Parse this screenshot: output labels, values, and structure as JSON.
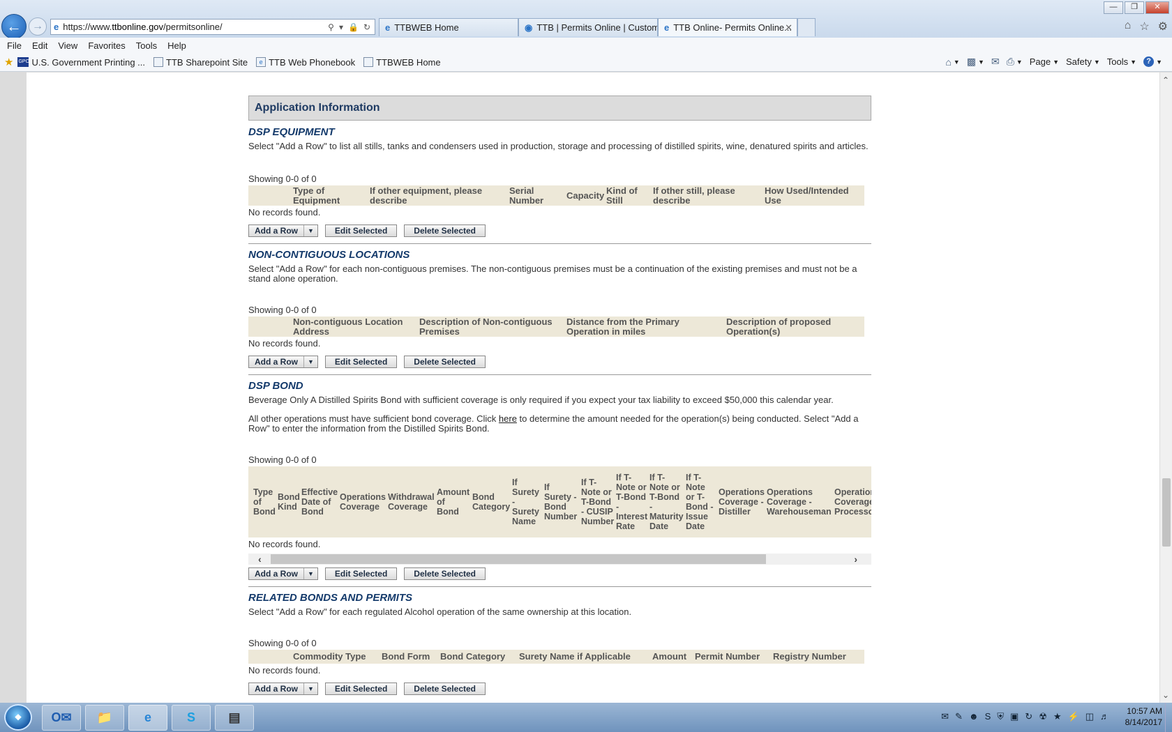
{
  "browser": {
    "url_prefix": "https://www.",
    "url_domain": "ttbonline.gov",
    "url_path": "/permitsonline/",
    "tabs": [
      {
        "label": "TTBWEB Home"
      },
      {
        "label": "TTB | Permits Online | Custom..."
      },
      {
        "label": "TTB Online- Permits Online..."
      }
    ],
    "menu": [
      "File",
      "Edit",
      "View",
      "Favorites",
      "Tools",
      "Help"
    ],
    "favorites": [
      "U.S. Government Printing ...",
      "TTB Sharepoint Site",
      "TTB Web Phonebook",
      "TTBWEB Home"
    ],
    "gpo_badge": "GPO",
    "commands": {
      "page": "Page",
      "safety": "Safety",
      "tools": "Tools"
    }
  },
  "page": {
    "app_info_title": "Application Information",
    "showing": "Showing 0-0 of 0",
    "no_records": "No records found.",
    "buttons": {
      "add_row": "Add a Row",
      "edit_selected": "Edit Selected",
      "delete_selected": "Delete Selected"
    },
    "dsp_equipment": {
      "title": "DSP EQUIPMENT",
      "description": "Select \"Add a Row\" to list all stills, tanks and condensers used in production, storage and processing of distilled spirits, wine, denatured spirits and articles.",
      "columns": [
        "Type of Equipment",
        "If other equipment, please describe",
        "Serial Number",
        "Capacity",
        "Kind of Still",
        "If other still, please describe",
        "How Used/Intended Use"
      ]
    },
    "noncontiguous": {
      "title": "NON-CONTIGUOUS LOCATIONS",
      "description": "Select \"Add a Row\" for each non-contiguous premises. The non-contiguous premises must be a continuation of the existing premises and must not be a stand alone operation.",
      "columns": [
        "Non-contiguous Location Address",
        "Description of Non-contiguous Premises",
        "Distance from the Primary Operation in miles",
        "Description of proposed Operation(s)"
      ]
    },
    "dsp_bond": {
      "title": "DSP BOND",
      "beverage_note": "Beverage Only  A Distilled Spirits Bond with sufficient coverage is only required if you expect your tax liability to exceed $50,000 this calendar year.",
      "other_ops_before": "All other operations must have sufficient bond coverage. Click ",
      "here_link": "here",
      "other_ops_after": " to determine the amount needed for the operation(s) being conducted. Select \"Add a Row\" to enter the information from the Distilled Spirits Bond.",
      "columns": [
        "Type of Bond",
        "Bond Kind",
        "Effective Date of Bond",
        "Operations Coverage",
        "Withdrawal Coverage",
        "Amount of Bond",
        "Bond Category",
        "If Surety - Surety Name",
        "If Surety - Bond Number",
        "If T-Note or T-Bond - CUSIP Number",
        "If T-Note or T-Bond - Interest Rate",
        "If T-Note or T-Bond - Maturity Date",
        "If T-Note or T-Bond - Issue Date",
        "Operations Coverage - Distiller",
        "Operations Coverage - Warehouseman",
        "Operations Coverage - Processor"
      ]
    },
    "related": {
      "title": "RELATED BONDS AND PERMITS",
      "description": "Select \"Add a Row\" for each regulated Alcohol operation of the same ownership at this location.",
      "columns": [
        "Commodity Type",
        "Bond Form",
        "Bond Category",
        "Surety Name if Applicable",
        "Amount",
        "Permit Number",
        "Registry Number"
      ]
    }
  },
  "taskbar": {
    "start_label": "Start",
    "time": "10:57 AM",
    "date": "8/14/2017"
  }
}
